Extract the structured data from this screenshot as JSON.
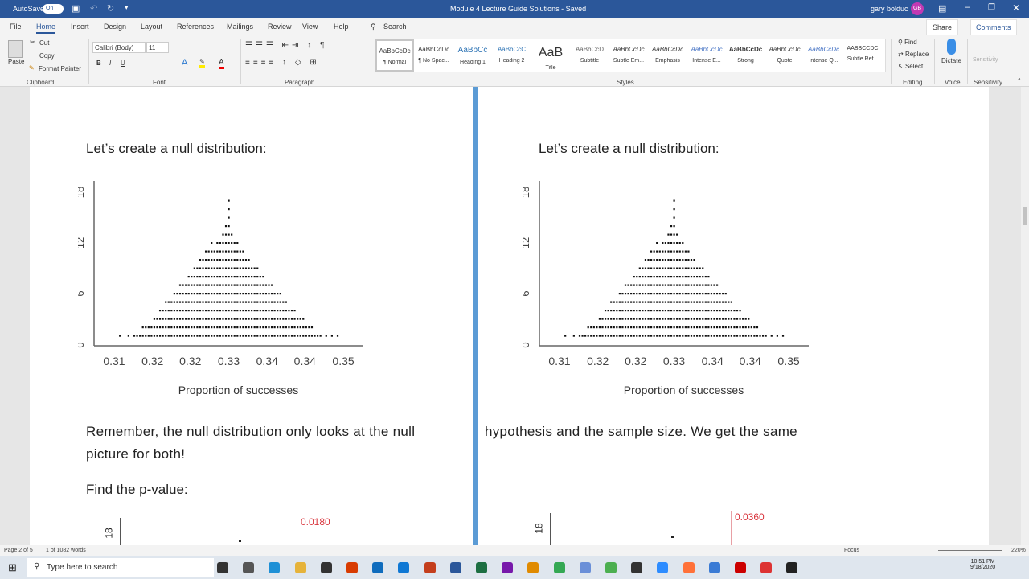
{
  "titlebar": {
    "autosave": "AutoSave",
    "autosave_state": "On",
    "doc_title": "Module 4 Lecture Guide Solutions - Saved",
    "user": "gary bolduc",
    "initials": "GB"
  },
  "tabs": [
    "File",
    "Home",
    "Insert",
    "Design",
    "Layout",
    "References",
    "Mailings",
    "Review",
    "View",
    "Help"
  ],
  "search_label": "Search",
  "share": "Share",
  "comments": "Comments",
  "ribbon": {
    "clipboard": {
      "paste": "Paste",
      "cut": "Cut",
      "copy": "Copy",
      "format_painter": "Format Painter",
      "label": "Clipboard"
    },
    "font": {
      "name": "Calibri (Body)",
      "size": "11",
      "label": "Font"
    },
    "paragraph": {
      "label": "Paragraph"
    },
    "styles": {
      "label": "Styles",
      "items": [
        {
          "preview": "AaBbCcDc",
          "name": "¶ Normal"
        },
        {
          "preview": "AaBbCcDc",
          "name": "¶ No Spac..."
        },
        {
          "preview": "AaBbCc",
          "name": "Heading 1"
        },
        {
          "preview": "AaBbCcC",
          "name": "Heading 2"
        },
        {
          "preview": "AaB",
          "name": "Title"
        },
        {
          "preview": "AaBbCcD",
          "name": "Subtitle"
        },
        {
          "preview": "AaBbCcDc",
          "name": "Subtle Em..."
        },
        {
          "preview": "AaBbCcDc",
          "name": "Emphasis"
        },
        {
          "preview": "AaBbCcDc",
          "name": "Intense E..."
        },
        {
          "preview": "AaBbCcDc",
          "name": "Strong"
        },
        {
          "preview": "AaBbCcDc",
          "name": "Quote"
        },
        {
          "preview": "AaBbCcDc",
          "name": "Intense Q..."
        },
        {
          "preview": "AABBCCDC",
          "name": "Subtle Ref..."
        }
      ]
    },
    "editing": {
      "find": "Find",
      "replace": "Replace",
      "select": "Select",
      "label": "Editing"
    },
    "voice": {
      "dictate": "Dictate",
      "label": "Voice"
    },
    "sensitivity": {
      "button": "Sensitivity",
      "label": "Sensitivity"
    }
  },
  "document": {
    "left_heading": "Let’s create a null distribution:",
    "right_heading": "Let’s create a null distribution:",
    "left_para_1": "Remember, the null distribution only looks at the null",
    "left_para_2": "picture for both!",
    "right_para": "hypothesis and the sample size.  We get the same",
    "find_pvalue": "Find the p-value:"
  },
  "chart_data": [
    {
      "type": "scatter",
      "subtype": "dotplot",
      "title": "",
      "xlabel": "Proportion of successes",
      "ylabel": "",
      "xlim": [
        0.3065,
        0.3535
      ],
      "ylim": [
        0,
        18
      ],
      "xticks": [
        0.31,
        0.3167,
        0.3233,
        0.33,
        0.3367,
        0.3433,
        0.35
      ],
      "xtick_labels": [
        "0.31",
        "0.32",
        "0.32",
        "0.33",
        "0.34",
        "0.34",
        "0.35"
      ],
      "yticks": [
        0,
        6,
        12,
        18
      ],
      "ytick_labels": [
        "0",
        "6",
        "12",
        "18"
      ],
      "x_start": 0.311,
      "x_step": 0.0005,
      "stack_heights": [
        1,
        0,
        0,
        1,
        0,
        1,
        1,
        1,
        2,
        2,
        2,
        2,
        3,
        3,
        4,
        4,
        5,
        5,
        5,
        6,
        6,
        7,
        7,
        7,
        8,
        8,
        9,
        9,
        10,
        10,
        11,
        11,
        12,
        11,
        12,
        12,
        13,
        14,
        17,
        13,
        12,
        12,
        11,
        11,
        10,
        10,
        9,
        9,
        9,
        8,
        8,
        7,
        7,
        7,
        6,
        6,
        6,
        5,
        5,
        4,
        4,
        4,
        3,
        3,
        3,
        2,
        2,
        2,
        1,
        1,
        1,
        0,
        1,
        0,
        1,
        0,
        1
      ]
    },
    {
      "type": "scatter",
      "subtype": "dotplot",
      "title": "",
      "xlabel": "Proportion of successes",
      "ylabel": "",
      "xlim": [
        0.3065,
        0.3535
      ],
      "ylim": [
        0,
        18
      ],
      "xticks": [
        0.31,
        0.3167,
        0.3233,
        0.33,
        0.3367,
        0.3433,
        0.35
      ],
      "xtick_labels": [
        "0.31",
        "0.32",
        "0.32",
        "0.33",
        "0.34",
        "0.34",
        "0.35"
      ],
      "yticks": [
        0,
        6,
        12,
        18
      ],
      "ytick_labels": [
        "0",
        "6",
        "12",
        "18"
      ],
      "x_start": 0.311,
      "x_step": 0.0005,
      "stack_heights": [
        1,
        0,
        0,
        1,
        0,
        1,
        1,
        1,
        2,
        2,
        2,
        2,
        3,
        3,
        4,
        4,
        5,
        5,
        5,
        6,
        6,
        7,
        7,
        7,
        8,
        8,
        9,
        9,
        10,
        10,
        11,
        11,
        12,
        11,
        12,
        12,
        13,
        14,
        17,
        13,
        12,
        12,
        11,
        11,
        10,
        10,
        9,
        9,
        9,
        8,
        8,
        7,
        7,
        7,
        6,
        6,
        6,
        5,
        5,
        4,
        4,
        4,
        3,
        3,
        3,
        2,
        2,
        2,
        1,
        1,
        1,
        0,
        1,
        0,
        1,
        0,
        1
      ]
    },
    {
      "type": "scatter",
      "subtype": "dotplot",
      "partial": true,
      "ytick_labels": [
        "18"
      ],
      "annotation": "0.0180"
    },
    {
      "type": "scatter",
      "subtype": "dotplot",
      "partial": true,
      "ytick_labels": [
        "18"
      ],
      "annotation": "0.0360"
    }
  ],
  "status": {
    "page": "Page 2 of 5",
    "words": "1 of 1082 words",
    "focus": "Focus",
    "zoom": "220%"
  },
  "taskbar": {
    "search_placeholder": "Type here to search",
    "time": "10:51 PM",
    "date": "9/18/2020"
  },
  "colors": {
    "title_blue": "#2b579a",
    "divider_blue": "#5b9bd5",
    "annotation_red": "#d9363e"
  }
}
